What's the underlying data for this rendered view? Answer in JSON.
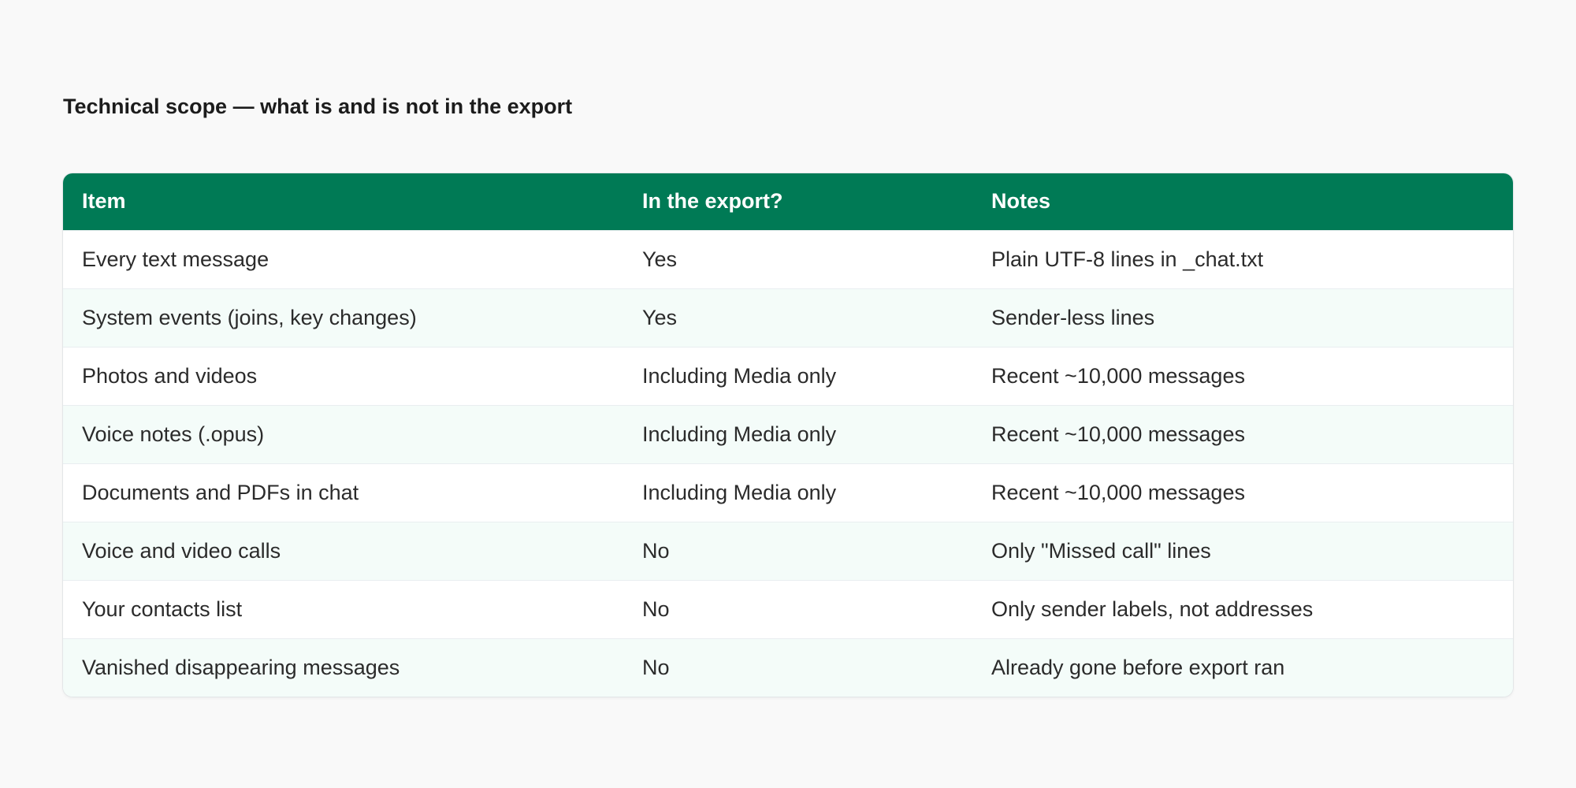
{
  "title": "Technical scope — what is and is not in the export",
  "table": {
    "headers": [
      "Item",
      "In the export?",
      "Notes"
    ],
    "rows": [
      [
        "Every text message",
        "Yes",
        "Plain UTF-8 lines in _chat.txt"
      ],
      [
        "System events (joins, key changes)",
        "Yes",
        "Sender-less lines"
      ],
      [
        "Photos and videos",
        "Including Media only",
        "Recent ~10,000 messages"
      ],
      [
        "Voice notes (.opus)",
        "Including Media only",
        "Recent ~10,000 messages"
      ],
      [
        "Documents and PDFs in chat",
        "Including Media only",
        "Recent ~10,000 messages"
      ],
      [
        "Voice and video calls",
        "No",
        "Only \"Missed call\" lines"
      ],
      [
        "Your contacts list",
        "No",
        "Only sender labels, not addresses"
      ],
      [
        "Vanished disappearing messages",
        "No",
        "Already gone before export ran"
      ]
    ]
  },
  "colors": {
    "header_bg": "#007a55",
    "stripe_bg": "#f4fcf9",
    "page_bg": "#f9f9f9"
  }
}
